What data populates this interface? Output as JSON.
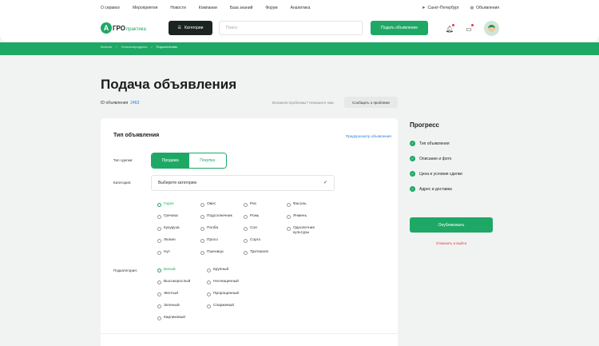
{
  "topbar": {
    "links": [
      "О сервисе",
      "Мероприятия",
      "Новости",
      "Компании",
      "База знаний",
      "Форум",
      "Аналитика"
    ],
    "city": "Санкт-Петербург",
    "ads": "Объявления"
  },
  "header": {
    "logo_a": "А",
    "logo_gro": "ГРО",
    "logo_praktika": "практика",
    "categories_label": "Категории",
    "search_placeholder": "Поиск",
    "submit_label": "Подать объявление"
  },
  "breadcrumbs": [
    "Каталог",
    "Сельхозпродукты",
    "Подсолнечник"
  ],
  "page": {
    "title": "Подача объявления",
    "id_label": "ID объявления",
    "id_value": "2463",
    "problem_question": "Возникли проблемы? Напишите нам",
    "report_label": "Сообщить о проблеме"
  },
  "form": {
    "section_title": "Тип объявления",
    "preview_link": "Предпросмотр объявления",
    "deal_label": "Тип сделки:",
    "deal_options": [
      "Продажа",
      "Покупка"
    ],
    "deal_selected": "Продажа",
    "category_label": "Категория:",
    "category_placeholder": "Выберите категорию",
    "categories": [
      [
        "Горох",
        "Гречиха",
        "Кукуруза",
        "Люпин",
        "Нут"
      ],
      [
        "Овес",
        "Подсолнечник",
        "Полба",
        "Просо",
        "Пшеница"
      ],
      [
        "Рис",
        "Рожь",
        "Соя",
        "Сорго",
        "Тритикале"
      ],
      [
        "Фасоль",
        "Ячмень",
        "Однолетние культуры"
      ]
    ],
    "category_selected": "Горох",
    "subcategory_label": "Подкатегория:",
    "subcategories": [
      [
        "Белый",
        "Высокорослый",
        "Желтый",
        "Зеленый",
        "Карликовый"
      ],
      [
        "Крупный",
        "Неочищенный",
        "Пророщенный",
        "Спаржевый"
      ]
    ],
    "subcategory_selected": "Белый"
  },
  "progress": {
    "title": "Прогресс",
    "steps": [
      "Тип объявления",
      "Описание и фото",
      "Цена и условия сделки",
      "Адрес и доставка"
    ],
    "publish_label": "Опубликовать",
    "cancel_label": "Отменить и выйти"
  },
  "colors": {
    "accent": "#1ea866",
    "dark": "#1c2421",
    "link": "#1e7bd6",
    "danger": "#d9433b"
  }
}
